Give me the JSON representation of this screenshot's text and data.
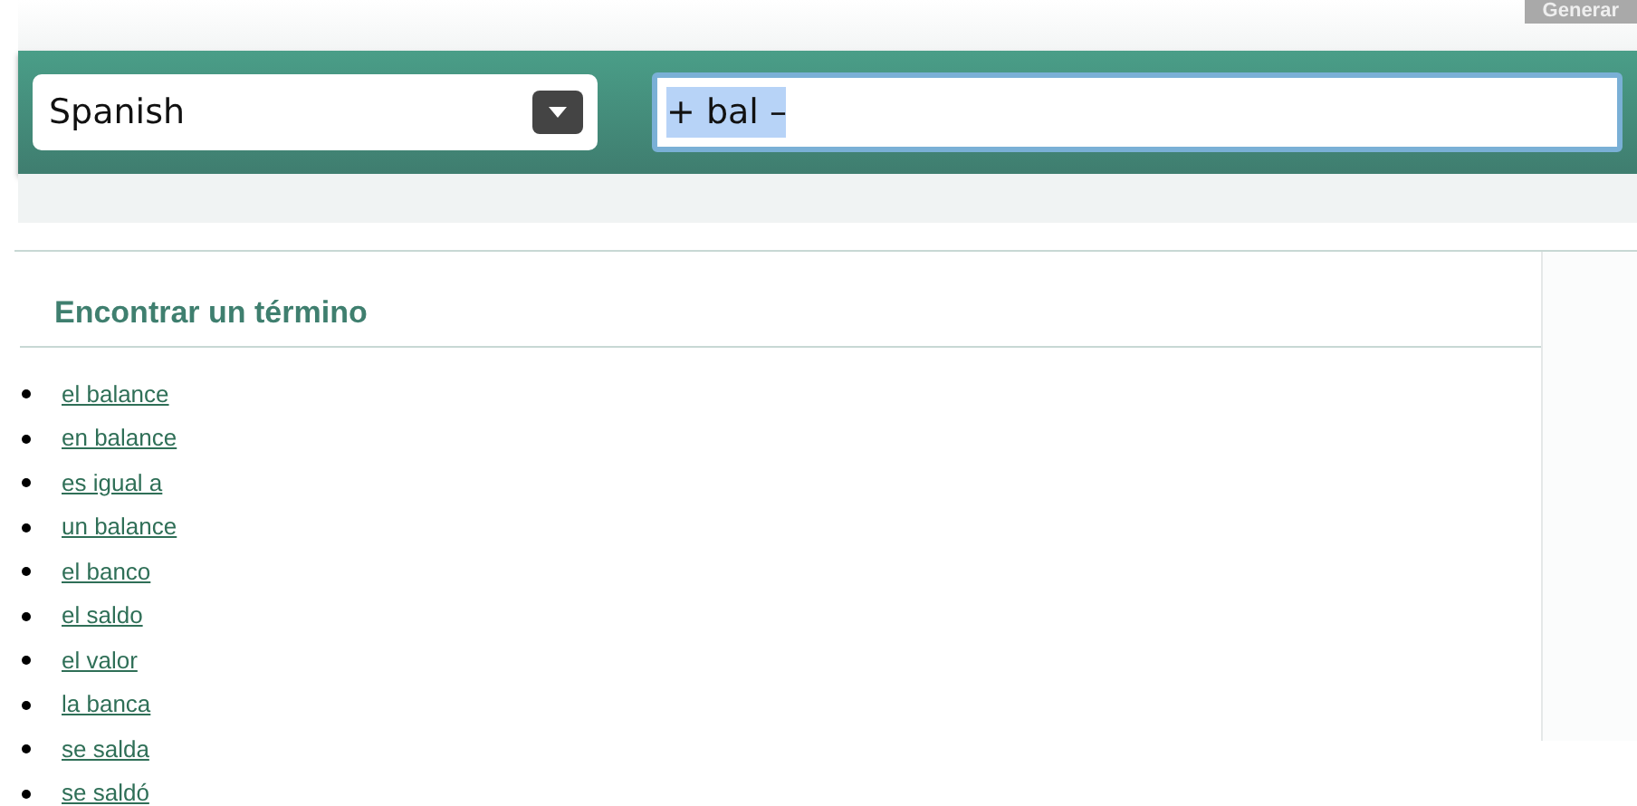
{
  "generate_button": {
    "label": "Generar"
  },
  "language_select": {
    "value": "Spanish"
  },
  "search": {
    "value": "+ bal –",
    "selected": true
  },
  "results": {
    "title": "Encontrar un término",
    "items": [
      "el balance",
      "en balance",
      "es igual a",
      "un balance",
      "el banco",
      "el saldo",
      "el valor",
      "la banca",
      "se salda",
      "se saldó"
    ]
  }
}
